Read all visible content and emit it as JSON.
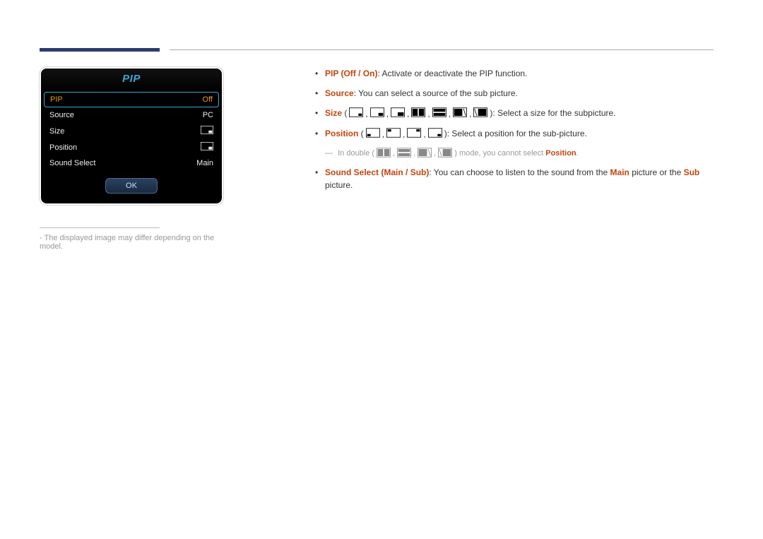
{
  "osd": {
    "title": "PIP",
    "rows": [
      {
        "label": "PIP",
        "value": "Off",
        "active": true,
        "iconType": null
      },
      {
        "label": "Source",
        "value": "PC",
        "active": false,
        "iconType": null
      },
      {
        "label": "Size",
        "value": "",
        "active": false,
        "iconType": "pip-small"
      },
      {
        "label": "Position",
        "value": "",
        "active": false,
        "iconType": "pip-pos"
      },
      {
        "label": "Sound Select",
        "value": "Main",
        "active": false,
        "iconType": null
      }
    ],
    "okLabel": "OK"
  },
  "footnote": "The displayed image may differ depending on the model.",
  "descriptions": {
    "pip_label": "PIP",
    "pip_options": "Off / On",
    "pip_text": ": Activate or deactivate the PIP function.",
    "source_label": "Source",
    "source_text": ": You can select a source of the sub picture.",
    "size_label": "Size",
    "size_text": ": Select a size for the subpicture.",
    "position_label": "Position",
    "position_text": ": Select a position for the sub-picture.",
    "note_prefix": "In double (",
    "note_suffix": ") mode, you cannot select ",
    "note_target": "Position",
    "note_period": ".",
    "sound_label": "Sound Select",
    "sound_options": "Main / Sub",
    "sound_text_a": ": You can choose to listen to the sound from the ",
    "sound_main": "Main",
    "sound_text_b": " picture or the ",
    "sound_sub": "Sub",
    "sound_text_c": " picture.",
    "paren_open": " (",
    "paren_close": ")",
    "slash_sep": " / "
  }
}
